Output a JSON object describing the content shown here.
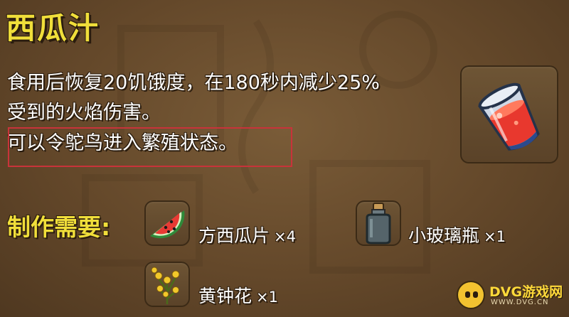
{
  "item": {
    "name": "西瓜汁",
    "icon": "watermelon-juice-icon"
  },
  "description": {
    "line1": "食用后恢复20饥饿度，在180秒内减少25%",
    "line2": "受到的火焰伤害。",
    "line3": "可以令鸵鸟进入繁殖状态。"
  },
  "recipe": {
    "label": "制作需要:",
    "ingredients": [
      {
        "name": "方西瓜片",
        "qty": "×4",
        "icon": "watermelon-slice-icon"
      },
      {
        "name": "小玻璃瓶",
        "qty": "×1",
        "icon": "small-glass-bottle-icon"
      },
      {
        "name": "黄钟花",
        "qty": "×1",
        "icon": "yellow-bell-flower-icon"
      }
    ]
  },
  "watermark": {
    "brand": "DVG游戏网",
    "url": "WWW.DVG.CN"
  },
  "colors": {
    "title": "#f0de3a",
    "text": "#ffffff",
    "highlight": "#c8333a",
    "background": "#64482a"
  }
}
